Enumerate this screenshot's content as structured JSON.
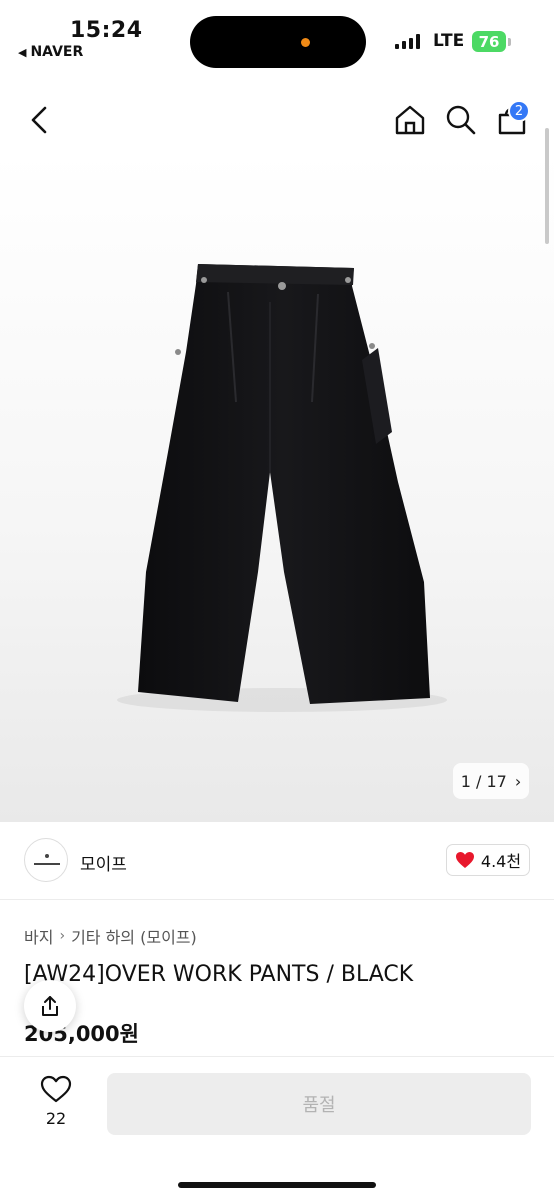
{
  "status_bar": {
    "time": "15:24",
    "back_app": "NAVER",
    "network": "LTE",
    "battery": "76"
  },
  "nav": {
    "cart_count": "2"
  },
  "gallery": {
    "counter": "1 / 17"
  },
  "brand": {
    "name": "모이프",
    "likes": "4.4천"
  },
  "product": {
    "breadcrumb": [
      "바지",
      "기타 하의 (모이프)"
    ],
    "title": "[AW24]OVER WORK PANTS / BLACK",
    "price": "205,000원"
  },
  "bottom_bar": {
    "wish_count": "22",
    "buy_button_label": "품절"
  },
  "colors": {
    "accent_blue": "#3478f6",
    "heart_red": "#e8182c",
    "battery_green": "#4cd964",
    "dot_orange": "#f08a16"
  }
}
